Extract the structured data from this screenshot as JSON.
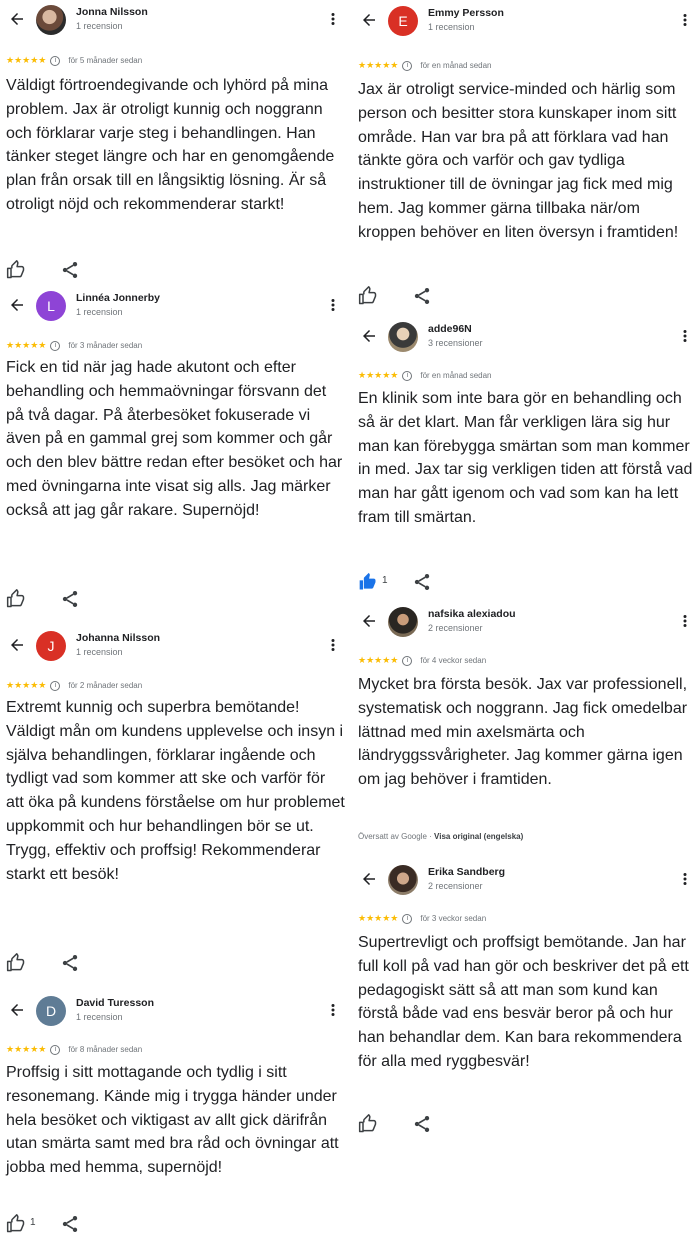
{
  "icons": {
    "back": "arrow-left-icon",
    "more": "more-vert-icon",
    "like": "thumb-up-icon",
    "share": "share-icon",
    "info": "info-icon"
  },
  "colors": {
    "star": "#fbbc04",
    "like_active": "#1a73e8",
    "avatar_linnea": "#8e44d6",
    "avatar_johanna": "#d93025",
    "avatar_david": "#5f7c95",
    "avatar_emmy": "#d93025"
  },
  "stars": "★★★★★",
  "info_glyph": "i",
  "reviews": [
    {
      "name": "Jonna Nilsson",
      "count": "1 recension",
      "date": "för 5 månader sedan",
      "text": "Väldigt förtroendegivande och lyhörd på mina problem. Jax är otroligt kunnig och noggrann och förklarar varje steg i behandlingen. Han tänker steget längre och har en genomgående plan från orsak till en långsiktig lösning. Är så otroligt nöjd och rekommenderar starkt!",
      "likes": ""
    },
    {
      "name": "Linnéa Jonnerby",
      "initial": "L",
      "count": "1 recension",
      "date": "för 3 månader sedan",
      "text": "Fick en tid när jag hade akutont och efter behandling och hemmaövningar försvann det på två dagar. På återbesöket fokuserade vi även på en gammal grej som kommer och går och den blev bättre redan efter besöket och har med övningarna inte visat sig alls. Jag märker också att jag går rakare. Supernöjd!",
      "likes": ""
    },
    {
      "name": "Johanna Nilsson",
      "initial": "J",
      "count": "1 recension",
      "date": "för 2 månader sedan",
      "text": "Extremt kunnig och superbra bemötande! Väldigt mån om kundens upplevelse och insyn i själva behandlingen, förklarar ingående och tydligt vad som kommer att ske och varför för att öka på kundens förståelse om hur problemet uppkommit och hur behandlingen bör se ut. Trygg, effektiv och proffsig! Rekommenderar starkt ett besök!",
      "likes": ""
    },
    {
      "name": "David Turesson",
      "initial": "D",
      "count": "1 recension",
      "date": "för 8 månader sedan",
      "text": "Proffsig i sitt mottagande och tydlig i sitt resonemang. Kände mig i trygga händer under hela besöket och viktigast av allt gick därifrån utan smärta samt med bra råd och övningar att jobba med hemma, supernöjd!",
      "likes": "1"
    },
    {
      "name": "Emmy Persson",
      "initial": "E",
      "count": "1 recension",
      "date": "för en månad sedan",
      "text": "Jax är otroligt service-minded och härlig som person och besitter stora kunskaper inom sitt område. Han var bra på att förklara vad han tänkte göra och varför och gav tydliga instruktioner till de övningar jag fick med mig hem. Jag kommer gärna tillbaka när/om kroppen behöver en liten översyn i framtiden!",
      "likes": ""
    },
    {
      "name": "adde96N",
      "count": "3 recensioner",
      "date": "för en månad sedan",
      "text": "En klinik som inte bara gör en behandling och så är det klart. Man får verkligen lära sig hur man kan förebygga smärtan som man kommer in med. Jax tar sig verkligen tiden att förstå vad man har gått igenom och vad som kan ha lett fram till smärtan.",
      "likes": "1"
    },
    {
      "name": "nafsika alexiadou",
      "count": "2 recensioner",
      "date": "för 4 veckor sedan",
      "text": "Mycket bra första besök. Jax var professionell, systematisk och noggrann. Jag fick omedelbar lättnad med min axelsmärta och ländryggssvårigheter. Jag kommer gärna igen om jag behöver i framtiden.",
      "translated_prefix": "Översatt av Google · ",
      "translated_link": "Visa original (engelska)",
      "likes": ""
    },
    {
      "name": "Erika Sandberg",
      "count": "2 recensioner",
      "date": "för 3 veckor sedan",
      "text": "Supertrevligt och proffsigt bemötande. Jan har full koll på vad han gör och beskriver det på ett pedagogiskt sätt så att man som kund kan förstå både vad ens besvär beror på och hur han behandlar dem. Kan bara rekommendera för alla med ryggbesvär!",
      "likes": ""
    }
  ]
}
